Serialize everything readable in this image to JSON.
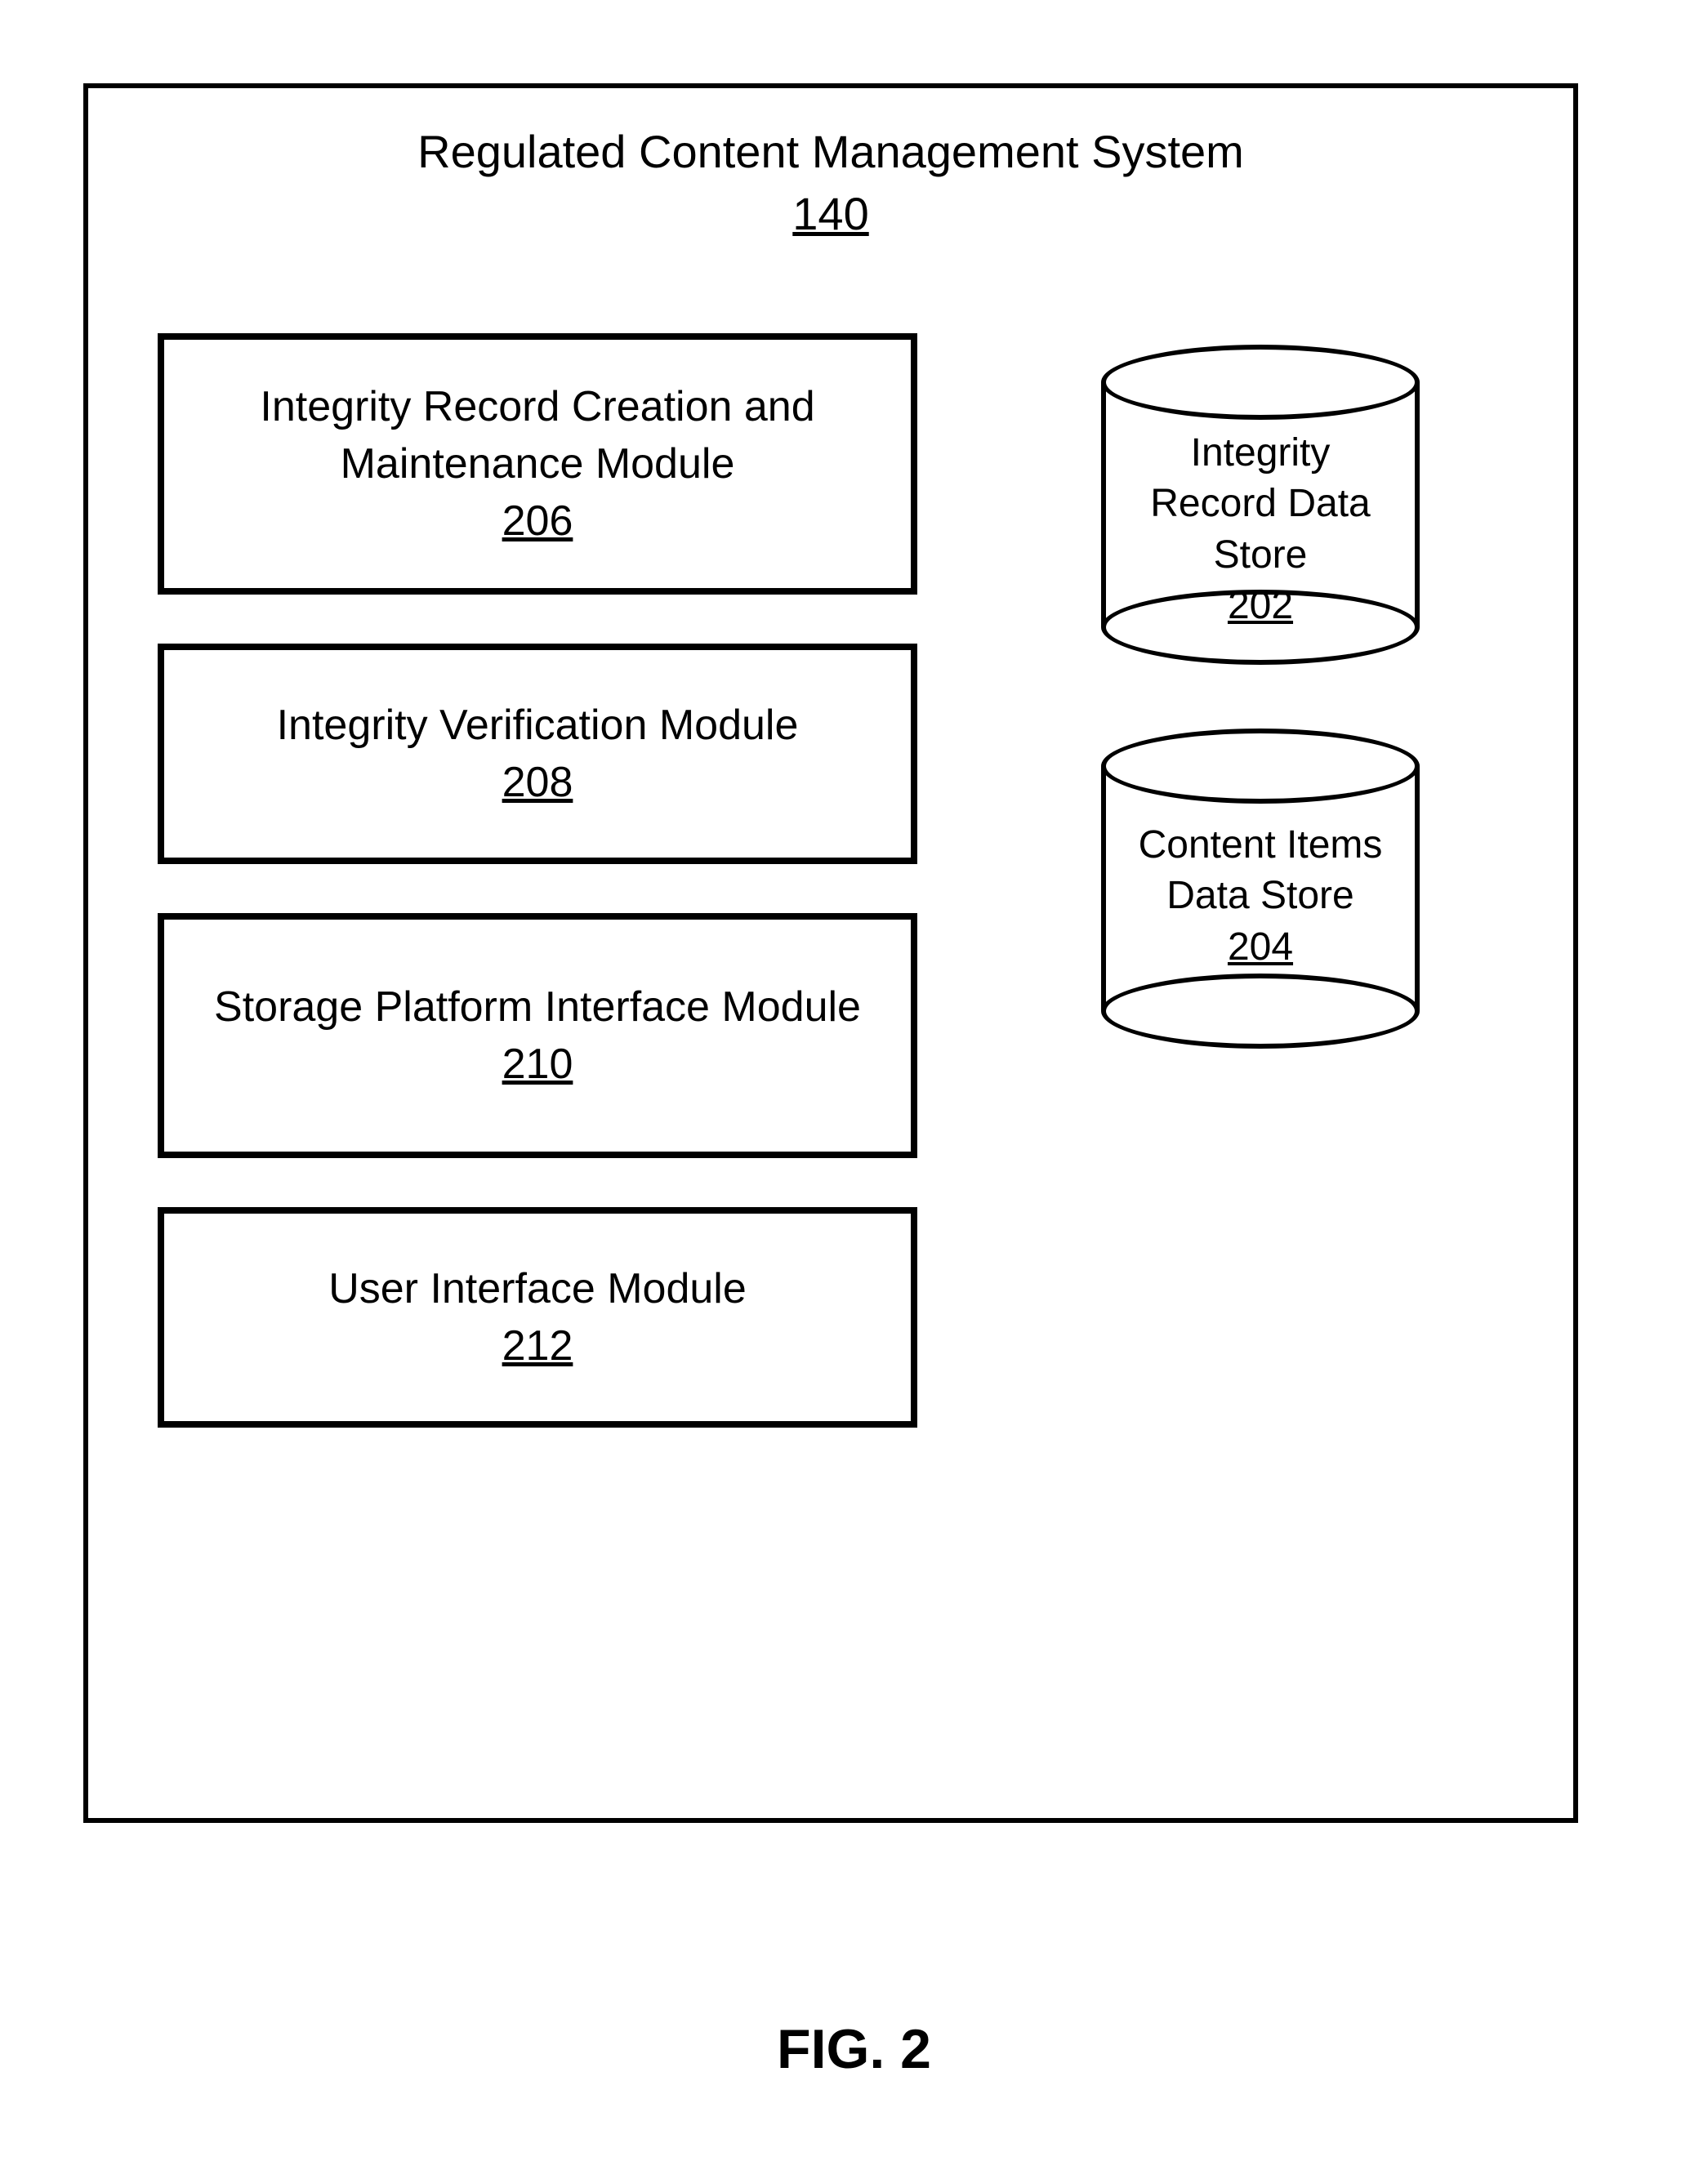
{
  "system": {
    "title": "Regulated Content Management System",
    "ref": "140"
  },
  "modules": [
    {
      "name": "Integrity Record Creation and Maintenance Module",
      "ref": "206"
    },
    {
      "name": "Integrity Verification Module",
      "ref": "208"
    },
    {
      "name": "Storage Platform Interface Module",
      "ref": "210"
    },
    {
      "name": "User Interface Module",
      "ref": "212"
    }
  ],
  "datastores": [
    {
      "name_line1": "Integrity",
      "name_line2": "Record Data",
      "name_line3": "Store",
      "ref": "202"
    },
    {
      "name_line1": "Content Items",
      "name_line2": "Data Store",
      "name_line3": "",
      "ref": "204"
    }
  ],
  "figure_caption": "FIG. 2"
}
